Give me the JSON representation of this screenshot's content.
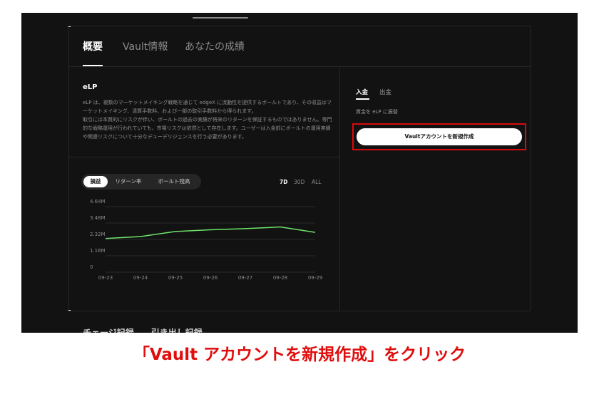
{
  "tabs": [
    "概要",
    "Vault情報",
    "あなたの成績"
  ],
  "vault": {
    "name": "eLP",
    "description": [
      "eLP は、複数のマーケットメイキング戦略を通じて edgeX に流動性を提供するボールトであり、その収益はマーケットメイキング、清算手数料、および一部の取引手数料から得られます。",
      "取引には本質的にリスクが伴い、ボールトの過去の実績が将来のリターンを保証するものではありません。専門的な戦略運用が行われていても、市場リスクは依然として存在します。ユーザーは入金前にボールトの運用実績や関連リスクについて十分なデューデリジェンスを行う必要があります。"
    ]
  },
  "chart_controls": {
    "metrics": [
      "損益",
      "リターン率",
      "ボールト残高"
    ],
    "active_metric": "損益",
    "ranges": [
      "7D",
      "30D",
      "ALL"
    ],
    "active_range": "7D"
  },
  "chart_data": {
    "type": "line",
    "title": "",
    "xlabel": "",
    "ylabel": "",
    "x": [
      "09-23",
      "09-24",
      "09-25",
      "09-26",
      "09-27",
      "09-28",
      "09-29"
    ],
    "values": [
      2.38,
      2.52,
      2.88,
      3.0,
      3.08,
      3.2,
      2.82
    ],
    "yticks": [
      "0",
      "1.16M",
      "2.32M",
      "3.48M",
      "4.64M"
    ],
    "ylim": [
      0,
      4.64
    ],
    "grid": true,
    "line_color": "#6ee36a"
  },
  "side_panel": {
    "tabs": [
      "入金",
      "出金"
    ],
    "active_tab": "入金",
    "note": "資金を eLP に振替",
    "button_label": "Vaultアカウントを新規作成"
  },
  "partial_bottom_text": "チェージ記録　　引き出し記録",
  "caption": "「Vault アカウントを新規作成」をクリック",
  "colors": {
    "highlight": "#d70b0b",
    "caption": "#e00d0d"
  }
}
